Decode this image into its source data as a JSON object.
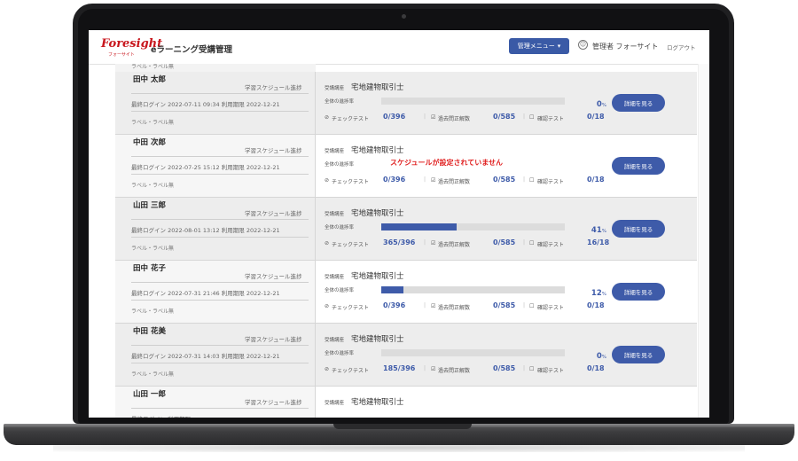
{
  "header": {
    "logo": "Foresight",
    "logo_sub": "フォーサイト",
    "app_title": "eラーニング受講管理",
    "menu_button": "管理メニュー",
    "user_name": "管理者 フォーサイト",
    "logout": "ログアウト"
  },
  "stub_text": "ラベル・ラベル無",
  "labels": {
    "schedule": "学習スケジュール進捗",
    "last_login": "最終ログイン",
    "expiry": "利用期限",
    "course_caption": "受講講座",
    "progress_label": "全体の進捗率",
    "check_test": "チェックテスト",
    "past_exam": "過去問正解数",
    "confirm_test": "確認テスト",
    "detail_button": "詳細を見る",
    "no_schedule": "スケジュールが設定されていません",
    "pct_unit": "%"
  },
  "rows": [
    {
      "name": "田中 太郎",
      "login": "2022-07-11 09:34",
      "expiry": "2022-12-21",
      "labels": "ラベル・ラベル無",
      "course": "宅地建物取引士",
      "progress": 0,
      "has_schedule": true,
      "pct": "0",
      "check": "0/396",
      "past": "0/585",
      "confirm": "0/18",
      "shaded": true
    },
    {
      "name": "中田 次郎",
      "login": "2022-07-25 15:12",
      "expiry": "2022-12-21",
      "labels": "ラベル・ラベル無",
      "course": "宅地建物取引士",
      "progress": 0,
      "has_schedule": false,
      "pct": "",
      "check": "0/396",
      "past": "0/585",
      "confirm": "0/18",
      "shaded": false
    },
    {
      "name": "山田 三郎",
      "login": "2022-08-01 13:12",
      "expiry": "2022-12-21",
      "labels": "ラベル・ラベル無",
      "course": "宅地建物取引士",
      "progress": 0.41,
      "has_schedule": true,
      "pct": "41",
      "check": "365/396",
      "past": "0/585",
      "confirm": "16/18",
      "shaded": true
    },
    {
      "name": "田中 花子",
      "login": "2022-07-31 21:46",
      "expiry": "2022-12-21",
      "labels": "ラベル・ラベル無",
      "course": "宅地建物取引士",
      "progress": 0.12,
      "has_schedule": true,
      "pct": "12",
      "check": "0/396",
      "past": "0/585",
      "confirm": "0/18",
      "shaded": false
    },
    {
      "name": "中田 花美",
      "login": "2022-07-31 14:03",
      "expiry": "2022-12-21",
      "labels": "ラベル・ラベル無",
      "course": "宅地建物取引士",
      "progress": 0,
      "has_schedule": true,
      "pct": "0",
      "check": "185/396",
      "past": "0/585",
      "confirm": "0/18",
      "shaded": true
    },
    {
      "name": "山田 一郎",
      "login": "",
      "expiry": "",
      "labels": "",
      "course": "宅地建物取引士",
      "progress": 0,
      "has_schedule": true,
      "pct": "",
      "check": "",
      "past": "",
      "confirm": "",
      "shaded": false
    }
  ]
}
